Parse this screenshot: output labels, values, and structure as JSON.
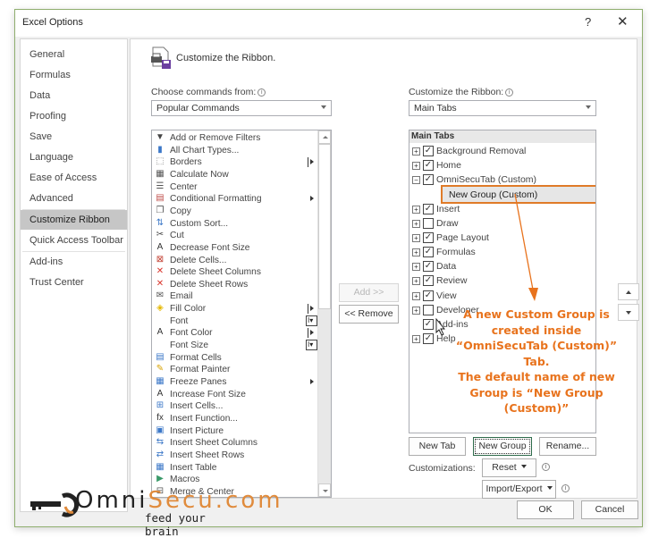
{
  "window": {
    "title": "Excel Options",
    "help_label": "?",
    "close_label": "✕"
  },
  "sidebar": {
    "items": [
      {
        "label": "General",
        "selected": false
      },
      {
        "label": "Formulas",
        "selected": false
      },
      {
        "label": "Data",
        "selected": false
      },
      {
        "label": "Proofing",
        "selected": false
      },
      {
        "label": "Save",
        "selected": false
      },
      {
        "label": "Language",
        "selected": false
      },
      {
        "label": "Ease of Access",
        "selected": false
      },
      {
        "label": "Advanced",
        "selected": false
      },
      {
        "label": "Customize Ribbon",
        "selected": true
      },
      {
        "label": "Quick Access Toolbar",
        "selected": false
      },
      {
        "label": "Add-ins",
        "selected": false
      },
      {
        "label": "Trust Center",
        "selected": false
      }
    ]
  },
  "main": {
    "heading": "Customize the Ribbon.",
    "choose_label": "Choose commands from:",
    "choose_value": "Popular Commands",
    "ribbon_label": "Customize the Ribbon:",
    "ribbon_value": "Main Tabs",
    "commands": [
      {
        "label": "Add or Remove Filters",
        "icon": "filter-icon",
        "glyph": "▼",
        "color": "#444",
        "submenu": ""
      },
      {
        "label": "All Chart Types...",
        "icon": "chart-icon",
        "glyph": "▮",
        "color": "#3c78c8",
        "submenu": ""
      },
      {
        "label": "Borders",
        "icon": "borders-icon",
        "glyph": "⬚",
        "color": "#888",
        "submenu": "bar-arrow"
      },
      {
        "label": "Calculate Now",
        "icon": "calculator-icon",
        "glyph": "▦",
        "color": "#555",
        "submenu": ""
      },
      {
        "label": "Center",
        "icon": "center-align-icon",
        "glyph": "☰",
        "color": "#555",
        "submenu": ""
      },
      {
        "label": "Conditional Formatting",
        "icon": "conditional-formatting-icon",
        "glyph": "▤",
        "color": "#c0504d",
        "submenu": "arrow"
      },
      {
        "label": "Copy",
        "icon": "copy-icon",
        "glyph": "❐",
        "color": "#555",
        "submenu": ""
      },
      {
        "label": "Custom Sort...",
        "icon": "sort-icon",
        "glyph": "⇅",
        "color": "#3c78c8",
        "submenu": ""
      },
      {
        "label": "Cut",
        "icon": "scissors-icon",
        "glyph": "✂",
        "color": "#444",
        "submenu": ""
      },
      {
        "label": "Decrease Font Size",
        "icon": "decrease-font-icon",
        "glyph": "A",
        "color": "#333",
        "submenu": ""
      },
      {
        "label": "Delete Cells...",
        "icon": "delete-cells-icon",
        "glyph": "⊠",
        "color": "#c0392b",
        "submenu": ""
      },
      {
        "label": "Delete Sheet Columns",
        "icon": "delete-columns-icon",
        "glyph": "✕",
        "color": "#d9342b",
        "submenu": ""
      },
      {
        "label": "Delete Sheet Rows",
        "icon": "delete-rows-icon",
        "glyph": "✕",
        "color": "#d9342b",
        "submenu": ""
      },
      {
        "label": "Email",
        "icon": "email-icon",
        "glyph": "✉",
        "color": "#555",
        "submenu": ""
      },
      {
        "label": "Fill Color",
        "icon": "fill-color-icon",
        "glyph": "◈",
        "color": "#e6b800",
        "submenu": "bar-arrow"
      },
      {
        "label": "Font",
        "icon": "",
        "glyph": "",
        "color": "#333",
        "submenu": "ibox"
      },
      {
        "label": "Font Color",
        "icon": "font-color-icon",
        "glyph": "A",
        "color": "#333",
        "submenu": "bar-arrow"
      },
      {
        "label": "Font Size",
        "icon": "",
        "glyph": "",
        "color": "#333",
        "submenu": "ibox"
      },
      {
        "label": "Format Cells",
        "icon": "format-cells-icon",
        "glyph": "▤",
        "color": "#3c78c8",
        "submenu": ""
      },
      {
        "label": "Format Painter",
        "icon": "format-painter-icon",
        "glyph": "✎",
        "color": "#d8a200",
        "submenu": ""
      },
      {
        "label": "Freeze Panes",
        "icon": "freeze-panes-icon",
        "glyph": "▦",
        "color": "#3c78c8",
        "submenu": "arrow"
      },
      {
        "label": "Increase Font Size",
        "icon": "increase-font-icon",
        "glyph": "A",
        "color": "#333",
        "submenu": ""
      },
      {
        "label": "Insert Cells...",
        "icon": "insert-cells-icon",
        "glyph": "⊞",
        "color": "#3c78c8",
        "submenu": ""
      },
      {
        "label": "Insert Function...",
        "icon": "function-icon",
        "glyph": "fx",
        "color": "#333",
        "submenu": ""
      },
      {
        "label": "Insert Picture",
        "icon": "picture-icon",
        "glyph": "▣",
        "color": "#3c78c8",
        "submenu": ""
      },
      {
        "label": "Insert Sheet Columns",
        "icon": "insert-columns-icon",
        "glyph": "⇆",
        "color": "#3c78c8",
        "submenu": ""
      },
      {
        "label": "Insert Sheet Rows",
        "icon": "insert-rows-icon",
        "glyph": "⇄",
        "color": "#3c78c8",
        "submenu": ""
      },
      {
        "label": "Insert Table",
        "icon": "table-icon",
        "glyph": "▦",
        "color": "#3c78c8",
        "submenu": ""
      },
      {
        "label": "Macros",
        "icon": "macros-icon",
        "glyph": "▶",
        "color": "#3a9a6a",
        "submenu": ""
      },
      {
        "label": "Merge & Center",
        "icon": "merge-center-icon",
        "glyph": "⊟",
        "color": "#555",
        "submenu": ""
      }
    ],
    "add_label": "Add >>",
    "remove_label": "<< Remove",
    "tree_header": "Main Tabs",
    "tabs": [
      {
        "label": "Background Removal",
        "expand": "+",
        "checked": true
      },
      {
        "label": "Home",
        "expand": "+",
        "checked": true
      },
      {
        "label": "OmniSecuTab (Custom)",
        "expand": "−",
        "checked": true
      },
      {
        "label": "",
        "expand": "",
        "checked": null
      },
      {
        "label": "Insert",
        "expand": "+",
        "checked": true
      },
      {
        "label": "Draw",
        "expand": "+",
        "checked": false
      },
      {
        "label": "Page Layout",
        "expand": "+",
        "checked": true
      },
      {
        "label": "Formulas",
        "expand": "+",
        "checked": true
      },
      {
        "label": "Data",
        "expand": "+",
        "checked": true
      },
      {
        "label": "Review",
        "expand": "+",
        "checked": true
      },
      {
        "label": "View",
        "expand": "+",
        "checked": true
      },
      {
        "label": "Developer",
        "expand": "+",
        "checked": false
      },
      {
        "label": "Add-ins",
        "expand": "",
        "checked": true
      },
      {
        "label": "Help",
        "expand": "+",
        "checked": true
      }
    ],
    "new_group_item": "New Group (Custom)",
    "new_tab_label": "New Tab",
    "new_group_label": "New Group",
    "rename_label": "Rename...",
    "customizations_label": "Customizations:",
    "reset_label": "Reset",
    "import_export_label": "Import/Export"
  },
  "annotation": {
    "lines": [
      "A new Custom Group is",
      "created inside",
      "“OmniSecuTab (Custom)”",
      "Tab.",
      "The default name of new",
      "Group is “New Group",
      "(Custom)”"
    ],
    "color": "#e8731d"
  },
  "footer": {
    "ok_label": "OK",
    "cancel_label": "Cancel"
  },
  "watermark": {
    "part1": "Omni",
    "part2": "Secu.com",
    "tagline": "feed your brain"
  }
}
